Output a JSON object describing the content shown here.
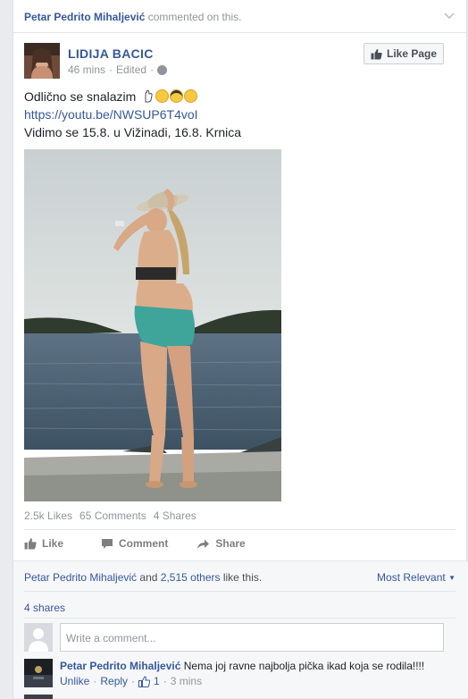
{
  "story_header": {
    "actor": "Petar Pedrito Mihaljević",
    "action": "commented on this."
  },
  "post": {
    "author": "LIDIJA BACIC",
    "time": "46 mins",
    "edited": "Edited",
    "like_page_label": "Like Page",
    "text_line1": "Odlično se snalazim",
    "link": "https://youtu.be/NWSUP6T4voI",
    "text_line3": "Vidimo se 15.8. u Vižinadi, 16.8. Krnica",
    "stats": {
      "likes": "2.5k Likes",
      "comments": "65 Comments",
      "shares": "4 Shares"
    }
  },
  "actions": {
    "like": "Like",
    "comment": "Comment",
    "share": "Share"
  },
  "ufi": {
    "likers_name": "Petar Pedrito Mihaljević",
    "and_text": "and",
    "others": "2,515 others",
    "like_this": "like this.",
    "most_relevant": "Most Relevant",
    "shares": "4 shares",
    "composer_placeholder": "Write a comment..."
  },
  "comment": {
    "author": "Petar Pedrito Mihaljević",
    "text": "Nema joj ravne najbolja pička ikad koja se rodila!!!!",
    "unlike": "Unlike",
    "reply": "Reply",
    "like_count": "1",
    "time": "3 mins"
  },
  "colors": {
    "link": "#365899",
    "muted": "#90949c",
    "background": "#e9ebee"
  }
}
